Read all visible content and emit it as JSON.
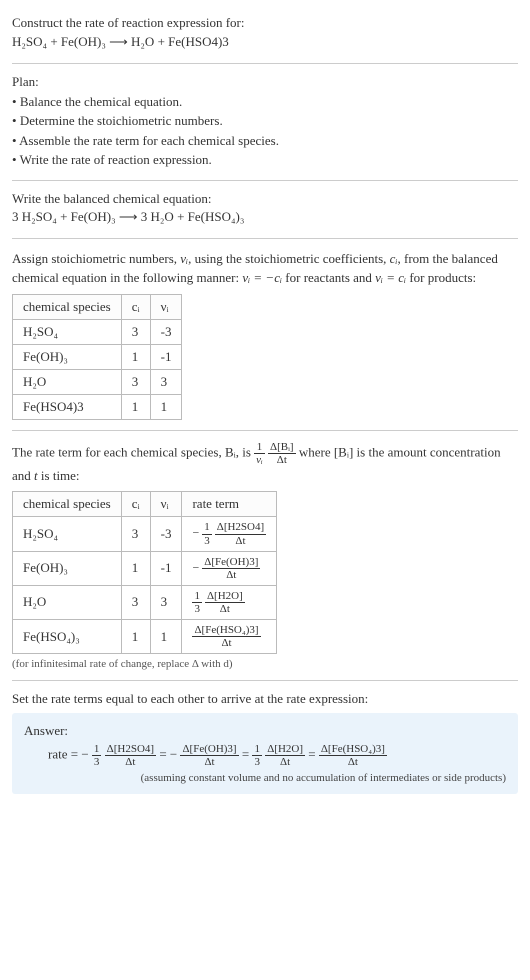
{
  "prompt": {
    "title": "Construct the rate of reaction expression for:",
    "equation": "H₂SO₄ + Fe(OH)₃ ⟶ H₂O + Fe(HSO4)3"
  },
  "plan": {
    "title": "Plan:",
    "items": [
      "Balance the chemical equation.",
      "Determine the stoichiometric numbers.",
      "Assemble the rate term for each chemical species.",
      "Write the rate of reaction expression."
    ]
  },
  "balanced": {
    "title": "Write the balanced chemical equation:",
    "equation": "3 H₂SO₄ + Fe(OH)₃ ⟶ 3 H₂O + Fe(HSO₄)₃"
  },
  "assign": {
    "text_pre": "Assign stoichiometric numbers, ",
    "nu": "νᵢ",
    "text_mid1": ", using the stoichiometric coefficients, ",
    "ci": "cᵢ",
    "text_mid2": ", from the balanced chemical equation in the following manner: ",
    "eq1": "νᵢ = −cᵢ",
    "text_mid3": " for reactants and ",
    "eq2": "νᵢ = cᵢ",
    "text_end": " for products:"
  },
  "table1": {
    "headers": [
      "chemical species",
      "cᵢ",
      "νᵢ"
    ],
    "rows": [
      [
        "H₂SO₄",
        "3",
        "-3"
      ],
      [
        "Fe(OH)₃",
        "1",
        "-1"
      ],
      [
        "H₂O",
        "3",
        "3"
      ],
      [
        "Fe(HSO4)3",
        "1",
        "1"
      ]
    ]
  },
  "rateterm": {
    "pre": "The rate term for each chemical species, Bᵢ, is ",
    "frac_left_num": "1",
    "frac_left_den": "νᵢ",
    "frac_right_num": "Δ[Bᵢ]",
    "frac_right_den": "Δt",
    "post": " where [Bᵢ] is the amount concentration and ",
    "t": "t",
    "post2": " is time:"
  },
  "table2": {
    "headers": [
      "chemical species",
      "cᵢ",
      "νᵢ",
      "rate term"
    ],
    "rows": [
      {
        "species": "H₂SO₄",
        "c": "3",
        "nu": "-3",
        "rt_prefix": "−",
        "rt_frac1_num": "1",
        "rt_frac1_den": "3",
        "rt_frac2_num": "Δ[H2SO4]",
        "rt_frac2_den": "Δt"
      },
      {
        "species": "Fe(OH)₃",
        "c": "1",
        "nu": "-1",
        "rt_prefix": "−",
        "rt_frac1_num": "",
        "rt_frac1_den": "",
        "rt_frac2_num": "Δ[Fe(OH)3]",
        "rt_frac2_den": "Δt"
      },
      {
        "species": "H₂O",
        "c": "3",
        "nu": "3",
        "rt_prefix": "",
        "rt_frac1_num": "1",
        "rt_frac1_den": "3",
        "rt_frac2_num": "Δ[H2O]",
        "rt_frac2_den": "Δt"
      },
      {
        "species": "Fe(HSO₄)₃",
        "c": "1",
        "nu": "1",
        "rt_prefix": "",
        "rt_frac1_num": "",
        "rt_frac1_den": "",
        "rt_frac2_num": "Δ[Fe(HSO₄)3]",
        "rt_frac2_den": "Δt"
      }
    ],
    "note": "(for infinitesimal rate of change, replace Δ with d)"
  },
  "final": {
    "title": "Set the rate terms equal to each other to arrive at the rate expression:"
  },
  "answer": {
    "title": "Answer:",
    "rate_label": "rate = ",
    "terms": [
      {
        "prefix": "−",
        "coef_num": "1",
        "coef_den": "3",
        "num": "Δ[H2SO4]",
        "den": "Δt"
      },
      {
        "prefix": "= −",
        "coef_num": "",
        "coef_den": "",
        "num": "Δ[Fe(OH)3]",
        "den": "Δt"
      },
      {
        "prefix": "= ",
        "coef_num": "1",
        "coef_den": "3",
        "num": "Δ[H2O]",
        "den": "Δt"
      },
      {
        "prefix": "= ",
        "coef_num": "",
        "coef_den": "",
        "num": "Δ[Fe(HSO₄)3]",
        "den": "Δt"
      }
    ],
    "note": "(assuming constant volume and no accumulation of intermediates or side products)"
  }
}
